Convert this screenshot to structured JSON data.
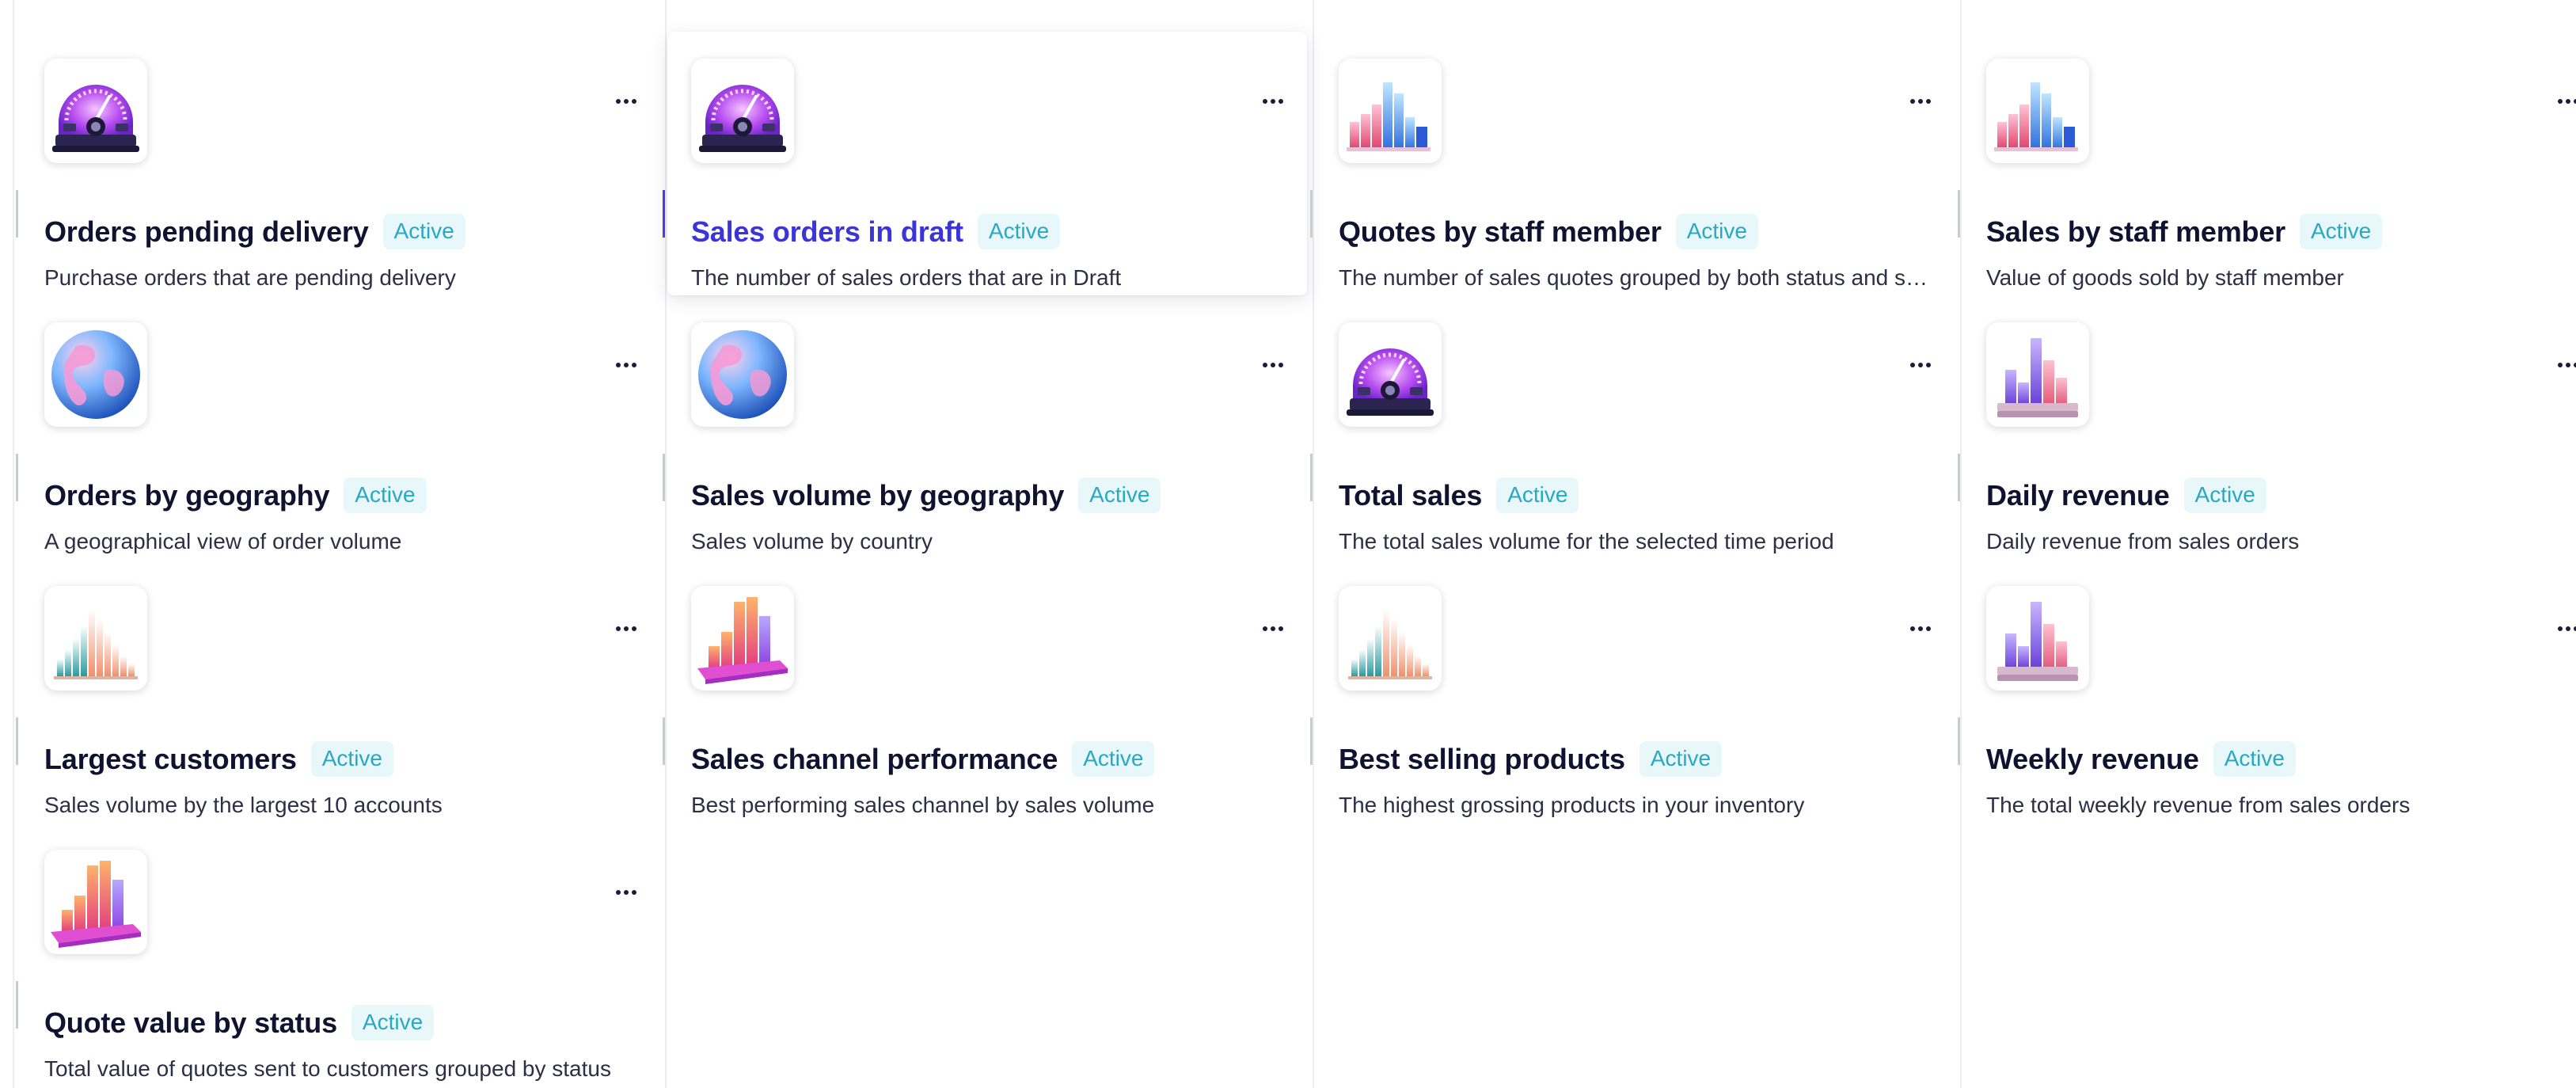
{
  "cards": [
    {
      "title": "Orders pending delivery",
      "status": "Active",
      "description": "Purchase orders that are pending delivery",
      "icon": "speedometer-icon"
    },
    {
      "title": "Sales orders in draft",
      "status": "Active",
      "description": "The number of sales orders that are in Draft",
      "icon": "speedometer-icon"
    },
    {
      "title": "Quotes by staff member",
      "status": "Active",
      "description": "The number of sales quotes grouped by both status and staff member",
      "icon": "bar-chart-3d-icon"
    },
    {
      "title": "Sales by staff member",
      "status": "Active",
      "description": "Value of goods sold by staff member",
      "icon": "bar-chart-3d-icon"
    },
    {
      "title": "Orders by geography",
      "status": "Active",
      "description": "A geographical view of order volume",
      "icon": "globe-icon"
    },
    {
      "title": "Sales volume by geography",
      "status": "Active",
      "description": "Sales volume by country",
      "icon": "globe-icon"
    },
    {
      "title": "Total sales",
      "status": "Active",
      "description": "The total sales volume for the selected time period",
      "icon": "speedometer-icon"
    },
    {
      "title": "Daily revenue",
      "status": "Active",
      "description": "Daily revenue from sales orders",
      "icon": "bar-chart-pedestal-icon"
    },
    {
      "title": "Largest customers",
      "status": "Active",
      "description": "Sales volume by the largest 10 accounts",
      "icon": "histogram-icon"
    },
    {
      "title": "Sales channel performance",
      "status": "Active",
      "description": "Best performing sales channel by sales volume",
      "icon": "bar-chart-platform-icon"
    },
    {
      "title": "Best selling products",
      "status": "Active",
      "description": "The highest grossing products in your inventory",
      "icon": "histogram-icon"
    },
    {
      "title": "Weekly revenue",
      "status": "Active",
      "description": "The total weekly revenue from sales orders",
      "icon": "bar-chart-pedestal-icon"
    },
    {
      "title": "Quote value by status",
      "status": "Active",
      "description": "Total value of quotes sent to customers grouped by status",
      "icon": "bar-chart-platform-icon"
    }
  ],
  "selected_card": "Sales orders in draft",
  "colors": {
    "title": "#0f1330",
    "selected_title": "#3b35d8",
    "badge_text": "#2aa8c2",
    "badge_bg": "#e8f7fa",
    "description": "#2c2f45"
  }
}
